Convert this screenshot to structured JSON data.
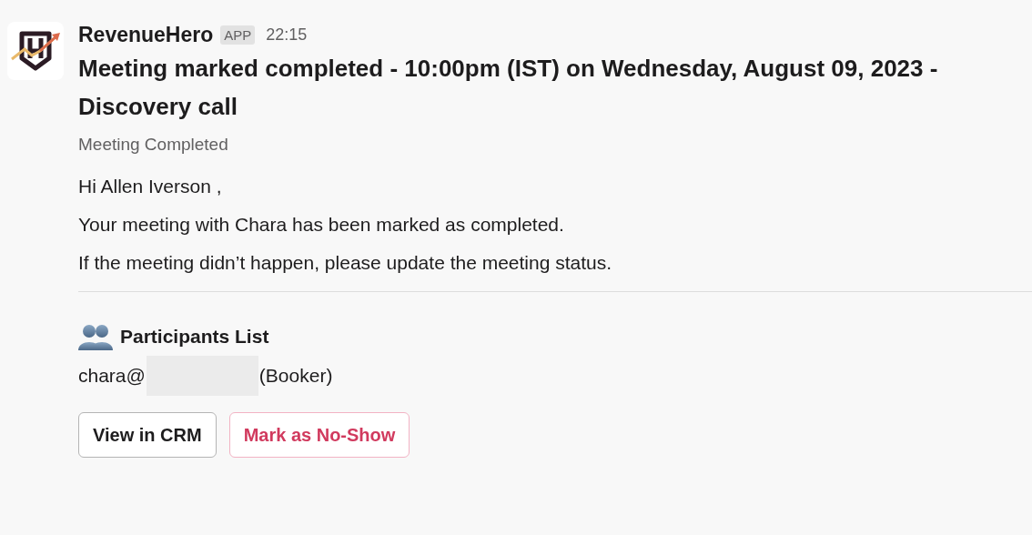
{
  "message": {
    "sender": "RevenueHero",
    "badge": "APP",
    "time": "22:15",
    "title": "Meeting marked completed - 10:00pm (IST) on Wednesday, August 09, 2023 - Discovery call",
    "subtitle": "Meeting Completed",
    "paragraphs": [
      "Hi Allen Iverson ,",
      "Your meeting with Chara has been marked as completed.",
      "If the meeting didn’t happen, please update the meeting status."
    ],
    "participants": {
      "heading": "Participants List",
      "entries": [
        {
          "email": "chara@",
          "role": "(Booker)"
        }
      ]
    },
    "buttons": [
      {
        "label": "View in CRM",
        "kind": "default"
      },
      {
        "label": "Mark as No-Show",
        "kind": "danger"
      }
    ]
  }
}
